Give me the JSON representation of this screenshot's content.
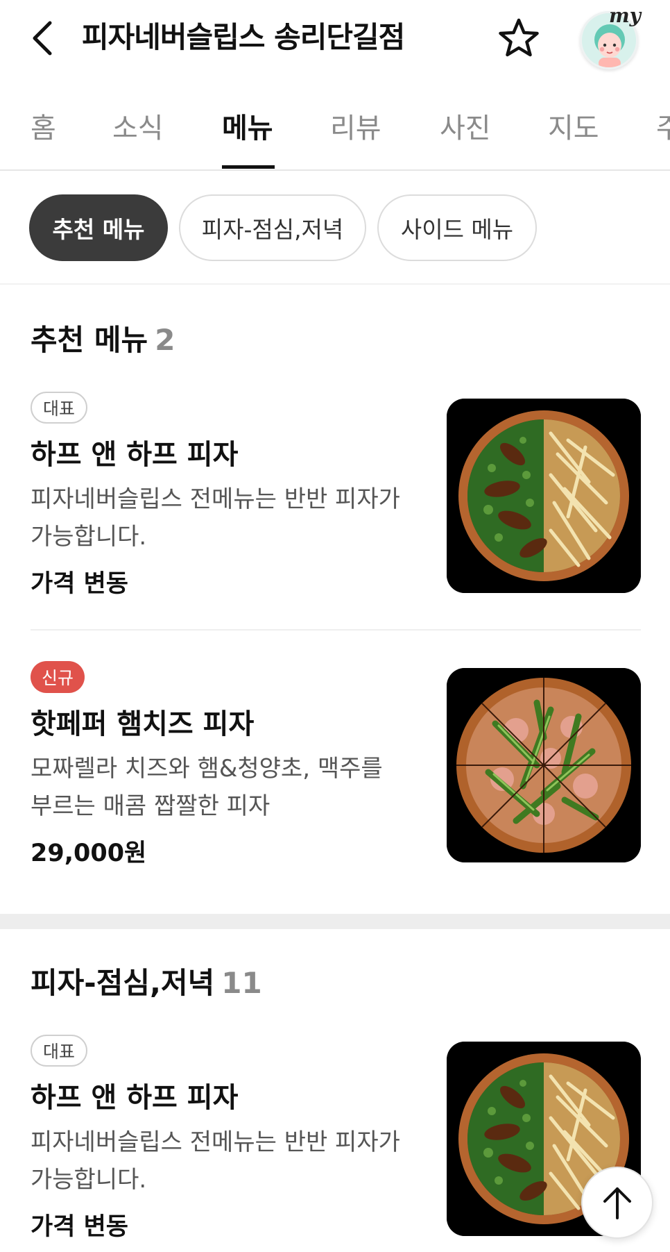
{
  "header": {
    "title": "피자네버슬립스 송리단길점",
    "my_label": "my",
    "icons": [
      "chevron-left-icon",
      "star-outline-icon"
    ]
  },
  "tabs": [
    {
      "label": "홈",
      "active": false
    },
    {
      "label": "소식",
      "active": false
    },
    {
      "label": "메뉴",
      "active": true
    },
    {
      "label": "리뷰",
      "active": false
    },
    {
      "label": "사진",
      "active": false
    },
    {
      "label": "지도",
      "active": false
    },
    {
      "label": "주",
      "active": false
    }
  ],
  "chips": [
    {
      "label": "추천 메뉴",
      "active": true
    },
    {
      "label": "피자-점심,저녁",
      "active": false
    },
    {
      "label": "사이드 메뉴",
      "active": false
    }
  ],
  "sections": [
    {
      "title": "추천 메뉴",
      "count": "2",
      "items": [
        {
          "badge": "대표",
          "name": "하프 앤 하프 피자",
          "desc": "피자네버슬립스 전메뉴는 반반 피자가 가능합니다.",
          "price": "가격 변동",
          "photo": "half-and-half-pizza"
        },
        {
          "badge": "신규",
          "name": "핫페퍼 햄치즈 피자",
          "desc": "모짜렐라 치즈와 햄&청양초, 맥주를 부르는 매콤 짭짤한 피자",
          "price": "29,000원",
          "photo": "hot-pepper-pizza"
        }
      ]
    },
    {
      "title": "피자-점심,저녁",
      "count": "11",
      "items": [
        {
          "badge": "대표",
          "name": "하프 앤 하프 피자",
          "desc": "피자네버슬립스 전메뉴는 반반 피자가 가능합니다.",
          "price": "가격 변동",
          "photo": "half-and-half-pizza"
        }
      ]
    }
  ],
  "colors": {
    "accent_badge_new": "#e0524b",
    "active_chip": "#3b3b3b"
  }
}
